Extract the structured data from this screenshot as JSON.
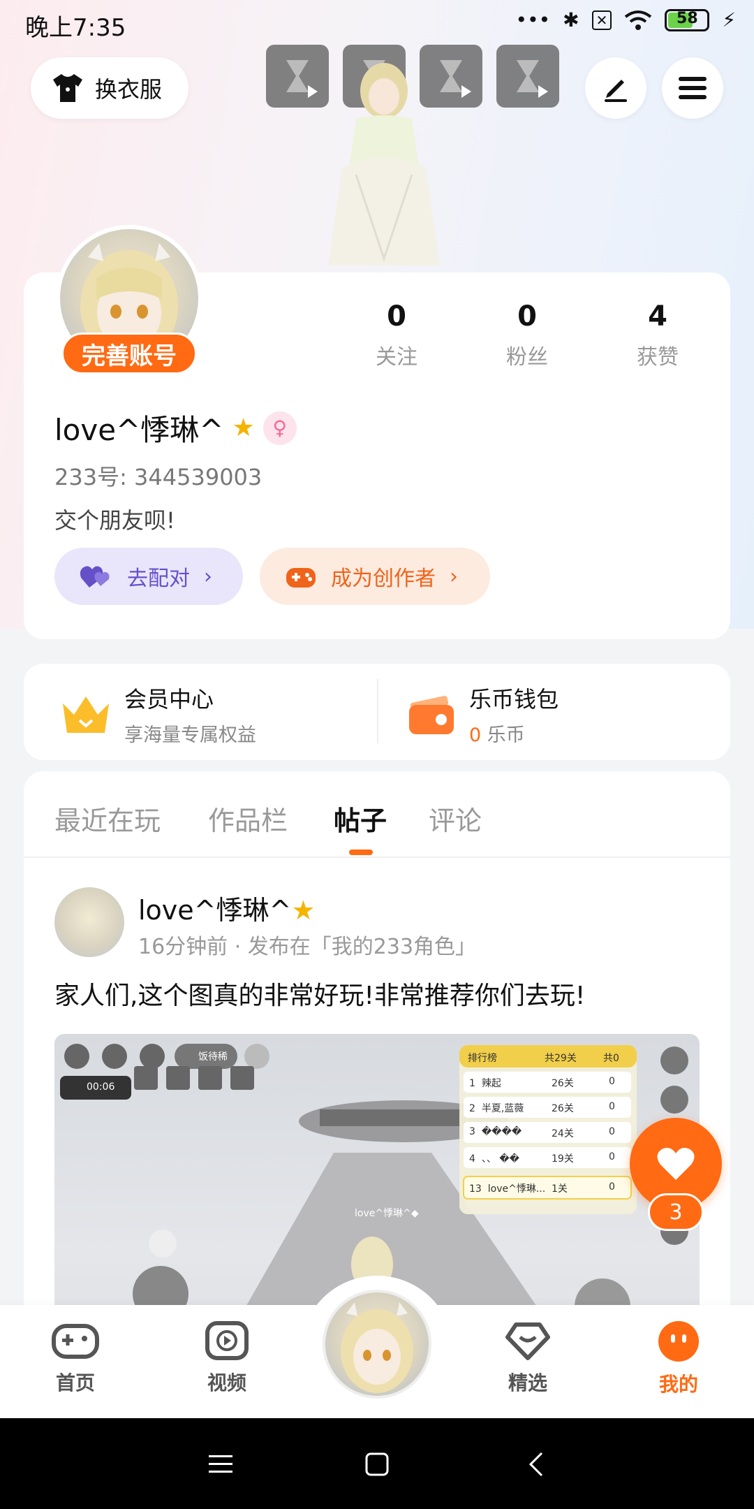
{
  "status_bar": {
    "time": "晚上7:35",
    "battery": "58"
  },
  "top_bar": {
    "outfit_label": "换衣服"
  },
  "profile": {
    "complete_account": "完善账号",
    "stats": [
      {
        "value": "0",
        "label": "关注"
      },
      {
        "value": "0",
        "label": "粉丝"
      },
      {
        "value": "4",
        "label": "获赞"
      }
    ],
    "username": "love^悸琳^",
    "uid": "233号: 344539003",
    "bio": "交个朋友呗!",
    "match_label": "去配对",
    "creator_label": "成为创作者"
  },
  "vip": {
    "member_title": "会员中心",
    "member_sub": "享海量专属权益",
    "wallet_title": "乐币钱包",
    "wallet_amount": "0",
    "wallet_unit": "乐币"
  },
  "tabs": [
    {
      "label": "最近在玩"
    },
    {
      "label": "作品栏"
    },
    {
      "label": "帖子"
    },
    {
      "label": "评论"
    }
  ],
  "post": {
    "user": "love^悸琳^",
    "meta": "16分钟前 · 发布在「我的233角色」",
    "text": "家人们,这个图真的非常好玩!非常推荐你们去玩!",
    "image": {
      "player_name": "饭待稀",
      "timer": "00:06",
      "ranking_title": "排行榜",
      "ranking_total": "共29关",
      "ranking_coin": "共0",
      "nameplate": "love^悸琳^◆",
      "ranks": [
        {
          "rank": "1",
          "name": "辣起",
          "level": "26关",
          "coins": "0"
        },
        {
          "rank": "2",
          "name": "半夏,蓝薇",
          "level": "26关",
          "coins": "0"
        },
        {
          "rank": "3",
          "name": "����",
          "level": "24关",
          "coins": "0"
        },
        {
          "rank": "4",
          "name": "、、 ��",
          "level": "19关",
          "coins": "0"
        },
        {
          "rank": "13",
          "name": "love^悸琳...",
          "level": "1关",
          "coins": "0"
        }
      ]
    }
  },
  "like_count": "3",
  "bottom_nav": [
    {
      "label": "首页"
    },
    {
      "label": "视频"
    },
    {
      "label": "精选"
    },
    {
      "label": "我的"
    }
  ],
  "colors": {
    "accent": "#ff6a13",
    "match": "#6650c8"
  }
}
